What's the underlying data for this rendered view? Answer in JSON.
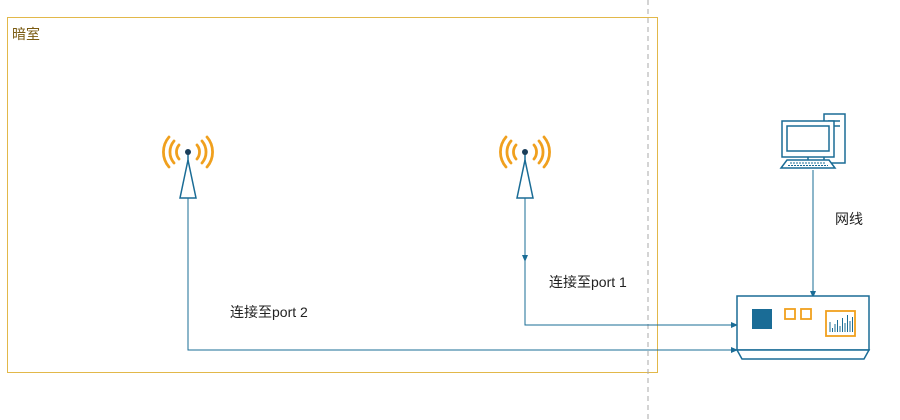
{
  "room": {
    "label": "暗室"
  },
  "labels": {
    "port2": "连接至port 2",
    "port1": "连接至port 1",
    "network": "网线"
  },
  "icons": [
    "antenna-icon",
    "antenna-icon",
    "computer-icon",
    "network-analyzer-icon"
  ],
  "colors": {
    "room_border": "#e2b84a",
    "blue": "#1a6c96",
    "orange": "#f0a01e",
    "dashed": "#aaaaaa"
  }
}
